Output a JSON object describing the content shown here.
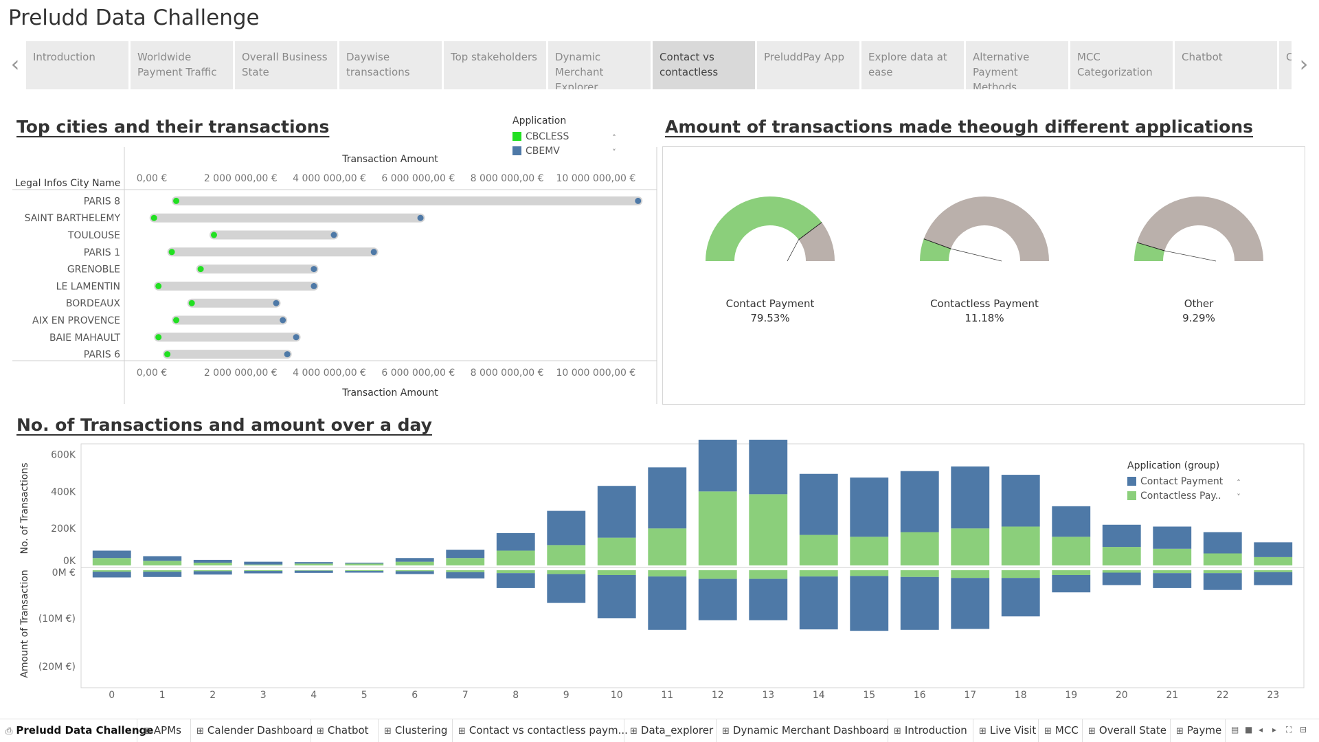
{
  "title": "Preludd Data Challenge",
  "tabs": [
    {
      "label": "Introduction"
    },
    {
      "label": "Worldwide Payment Traffic"
    },
    {
      "label": "Overall Business State"
    },
    {
      "label": "Daywise transactions"
    },
    {
      "label": "Top stakeholders"
    },
    {
      "label": "Dynamic Merchant Explorer"
    },
    {
      "label": "Contact vs contactless"
    },
    {
      "label": "PreluddPay App"
    },
    {
      "label": "Explore data at ease"
    },
    {
      "label": "Alternative Payment Methods"
    },
    {
      "label": "MCC Categorization"
    },
    {
      "label": "Chatbot"
    },
    {
      "label": "C"
    }
  ],
  "active_tab": 6,
  "nav": {
    "prev": "‹",
    "next": "›"
  },
  "section1": {
    "title": "Top cities and their transactions"
  },
  "section2": {
    "title": "Amount of transactions made theough different applications"
  },
  "section3": {
    "title": "No. of Transactions and amount over a day"
  },
  "dumbbell_legend": {
    "title": "Application",
    "items": [
      {
        "label": "CBCLESS",
        "color": "#22e022"
      },
      {
        "label": "CBEMV",
        "color": "#4e79a7"
      }
    ],
    "scroll_up": "˄",
    "scroll_down": "˅"
  },
  "gauges": [
    {
      "label": "Contact Payment",
      "value_text": "79.53%",
      "pct": 0.7953,
      "fill": "#8bcf7b",
      "rest": "#bab0ab"
    },
    {
      "label": "Contactless Payment",
      "value_text": "11.18%",
      "pct": 0.1118,
      "fill": "#8bcf7b",
      "rest": "#bab0ab"
    },
    {
      "label": "Other",
      "value_text": "9.29%",
      "pct": 0.0929,
      "fill": "#8bcf7b",
      "rest": "#bab0ab"
    }
  ],
  "bar_legend": {
    "title": "Application (group)",
    "items": [
      {
        "label": "Contact Payment",
        "color": "#4e79a7"
      },
      {
        "label": "Contactless Pay..",
        "color": "#8bcf7b"
      }
    ],
    "scroll_up": "˄",
    "scroll_down": "˅"
  },
  "chart_data": [
    {
      "type": "scatter",
      "subtype": "dumbbell",
      "title": "Top cities and their transactions",
      "xlabel": "Transaction Amount",
      "ylabel": "Legal Infos City Name",
      "xlim": [
        0,
        11000000
      ],
      "x_ticks": [
        0,
        2000000,
        4000000,
        6000000,
        8000000,
        10000000
      ],
      "x_tick_labels": [
        "0,00 €",
        "2 000 000,00 €",
        "4 000 000,00 €",
        "6 000 000,00 €",
        "8 000 000,00 €",
        "10 000 000,00 €"
      ],
      "categories": [
        "PARIS 8",
        "SAINT BARTHELEMY",
        "TOULOUSE",
        "PARIS 1",
        "GRENOBLE",
        "LE LAMENTIN",
        "BORDEAUX",
        "AIX EN PROVENCE",
        "BAIE MAHAULT",
        "PARIS 6"
      ],
      "series": [
        {
          "name": "CBCLESS",
          "color": "#22e022",
          "values": [
            550000,
            50000,
            1400000,
            450000,
            1100000,
            150000,
            900000,
            550000,
            150000,
            350000
          ]
        },
        {
          "name": "CBEMV",
          "color": "#4e79a7",
          "values": [
            10950000,
            6050000,
            4100000,
            5000000,
            3650000,
            3650000,
            2800000,
            2950000,
            3250000,
            3050000
          ]
        }
      ]
    },
    {
      "type": "bar",
      "subtype": "stacked-diverging",
      "title": "No. of Transactions and amount over a day",
      "categories": [
        "0",
        "1",
        "2",
        "3",
        "4",
        "5",
        "6",
        "7",
        "8",
        "9",
        "10",
        "11",
        "12",
        "13",
        "14",
        "15",
        "16",
        "17",
        "18",
        "19",
        "20",
        "21",
        "22",
        "23"
      ],
      "top_axis": {
        "label": "No. of Transactions",
        "ylim": [
          0,
          650000
        ],
        "ticks": [
          0,
          200000,
          400000,
          600000
        ],
        "tick_labels": [
          "0K",
          "200K",
          "400K",
          "600K"
        ]
      },
      "bottom_axis": {
        "label": "Amount of Transaction",
        "ylim": [
          0,
          24000000
        ],
        "ticks": [
          0,
          10000000,
          20000000
        ],
        "tick_labels": [
          "0M €",
          "(10M €)",
          "(20M €)"
        ]
      },
      "series": [
        {
          "name": "Contact Payment",
          "color": "#4e79a7",
          "transactions": [
            40000,
            25000,
            15000,
            15000,
            8000,
            5000,
            20000,
            45000,
            95000,
            185000,
            280000,
            330000,
            320000,
            330000,
            330000,
            320000,
            330000,
            335000,
            280000,
            165000,
            120000,
            120000,
            115000,
            80000
          ],
          "amount": [
            1200000,
            1100000,
            700000,
            500000,
            450000,
            350000,
            600000,
            1300000,
            3100000,
            6000000,
            9000000,
            11100000,
            8600000,
            8600000,
            11000000,
            11400000,
            11000000,
            10600000,
            8000000,
            3600000,
            2600000,
            3100000,
            3500000,
            2700000
          ]
        },
        {
          "name": "Contactless Payment",
          "color": "#8bcf7b",
          "transactions": [
            40000,
            25000,
            15000,
            5000,
            10000,
            10000,
            20000,
            40000,
            80000,
            110000,
            150000,
            200000,
            400000,
            385000,
            165000,
            155000,
            180000,
            200000,
            210000,
            155000,
            100000,
            90000,
            65000,
            45000
          ],
          "amount": [
            300000,
            300000,
            200000,
            150000,
            100000,
            150000,
            200000,
            400000,
            600000,
            800000,
            1000000,
            1300000,
            1800000,
            1800000,
            1300000,
            1200000,
            1400000,
            1600000,
            1600000,
            1000000,
            500000,
            600000,
            600000,
            400000
          ]
        }
      ]
    }
  ],
  "sheets": [
    {
      "label": "Preludd Data Challenge",
      "icon": "⎙"
    },
    {
      "label": "APMs",
      "icon": "⊞"
    },
    {
      "label": "Calender Dashboard",
      "icon": "⊞"
    },
    {
      "label": "Chatbot",
      "icon": "⊞"
    },
    {
      "label": "Clustering",
      "icon": "⊞"
    },
    {
      "label": "Contact vs contactless paym...",
      "icon": "⊞"
    },
    {
      "label": "Data_explorer",
      "icon": "⊞"
    },
    {
      "label": "Dynamic Merchant Dashboard",
      "icon": "⊞"
    },
    {
      "label": "Introduction",
      "icon": "⊞"
    },
    {
      "label": "Live Visit",
      "icon": "⊞"
    },
    {
      "label": "MCC",
      "icon": "⊞"
    },
    {
      "label": "Overall State",
      "icon": "⊞"
    },
    {
      "label": "Payme",
      "icon": "⊞"
    }
  ],
  "sheet_controls": [
    "▤",
    "■",
    "◂",
    "▸",
    "⛶",
    "⊟"
  ]
}
